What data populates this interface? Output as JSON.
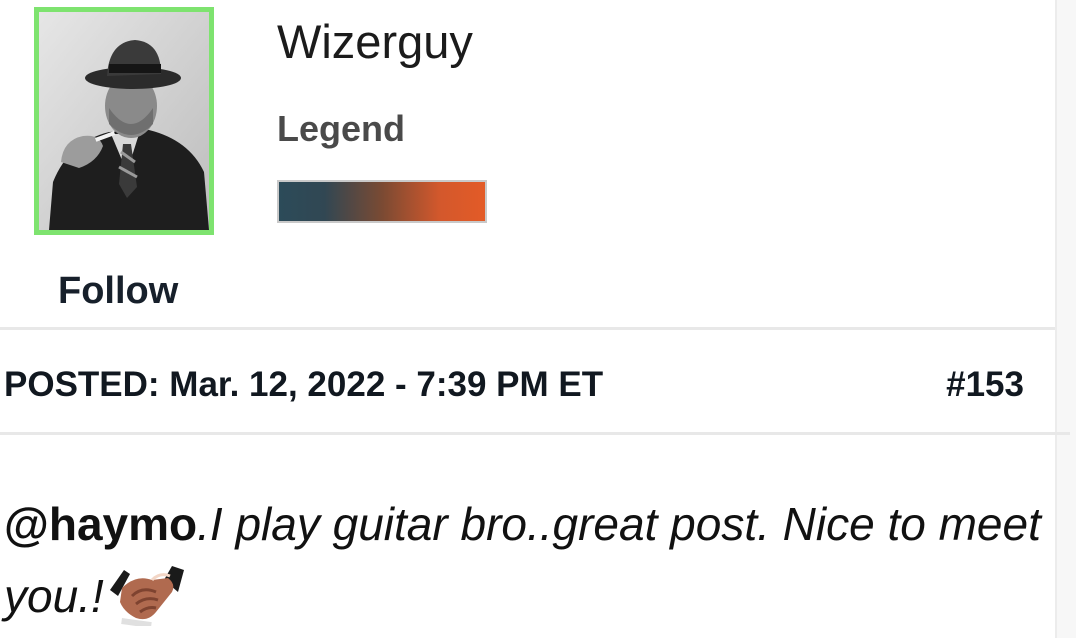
{
  "profile": {
    "username": "Wizerguy",
    "rank": "Legend",
    "rank_bar_colors": [
      "#2c4b59",
      "#e35b27"
    ],
    "avatar_border_color": "#7ee36f",
    "follow_label": "Follow"
  },
  "post": {
    "meta": "POSTED: Mar. 12, 2022 - 7:39 PM ET",
    "number": "#153",
    "mention": "@haymo",
    "text": ".I play guitar bro..great post. Nice to meet you.!",
    "emoji": "handshake-icon"
  }
}
